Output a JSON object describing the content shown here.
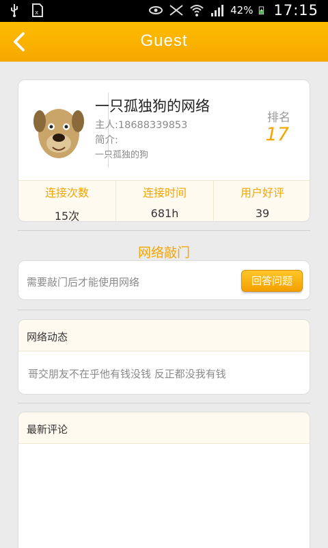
{
  "status_bar": {
    "left_icons": [
      "usb-icon",
      "sim-icon"
    ],
    "right_icons": [
      "eye-icon",
      "no-signal-icon",
      "wifi-icon",
      "signal-icon",
      "battery-icon"
    ],
    "battery_percent": "42%",
    "time": "17:15"
  },
  "header": {
    "title": "Guest",
    "back_icon": "chevron-left-icon"
  },
  "profile": {
    "avatar_icon": "dog-avatar",
    "network_name": "一只孤独狗的网络",
    "owner": "主人:18688339853",
    "intro_label": "简介:",
    "intro_text": "一只孤独的狗",
    "rank_label": "排名",
    "rank_value": "17"
  },
  "stats": [
    {
      "label": "连接次数",
      "value": "15次"
    },
    {
      "label": "连接时间",
      "value": "681h"
    },
    {
      "label": "用户好评",
      "value": "39"
    }
  ],
  "knock": {
    "title": "网络敲门",
    "hint": "需要敲门后才能使用网络",
    "button_label": "回答问题"
  },
  "dynamics": {
    "header": "网络动态",
    "text": "哥交朋友不在乎他有钱没钱 反正都没我有钱"
  },
  "comments": {
    "header": "最新评论"
  },
  "colors": {
    "accent": "#f5a500",
    "titlebar": "#fdb400",
    "background": "#ebebeb"
  }
}
